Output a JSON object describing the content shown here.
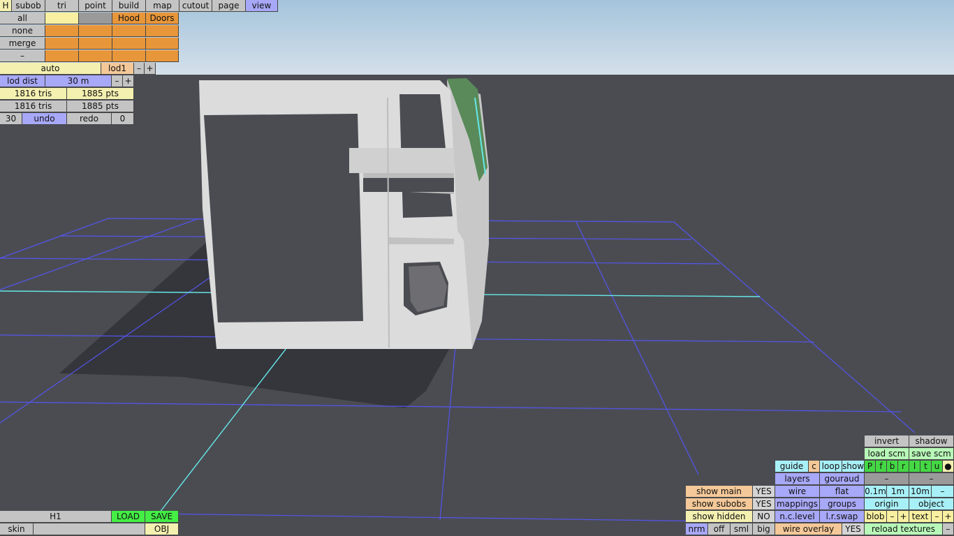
{
  "scene": {
    "colors": {
      "sky_top": "#a4c4dc",
      "sky_bottom": "#d4e0ea",
      "floor": "#4a4c52",
      "grid": "#5555ee",
      "axis": "#66e8e8",
      "body": "#d8d8d8",
      "stripe": "#5a8a5a",
      "shadow": "#34363c"
    }
  },
  "toolbar": {
    "modes": [
      "H",
      "subob",
      "tri",
      "point",
      "build",
      "map",
      "cutout",
      "page",
      "view"
    ],
    "active_mode": "view"
  },
  "subobjects": {
    "side_buttons": [
      "all",
      "none",
      "merge",
      "–"
    ],
    "named": [
      "Hood",
      "Doors"
    ]
  },
  "lod": {
    "auto": "auto",
    "level": "lod1",
    "minus": "–",
    "plus": "+",
    "dist_label": "lod dist",
    "dist_value": "30 m"
  },
  "stats": {
    "tris1": "1816 tris",
    "pts1": "1885 pts",
    "tris2": "1816 tris",
    "pts2": "1885 pts"
  },
  "history": {
    "count": "30",
    "undo": "undo",
    "redo": "redo",
    "redo_count": "0"
  },
  "file": {
    "name": "H1",
    "load": "LOAD",
    "save": "SAVE",
    "skin": "skin",
    "obj": "OBJ"
  },
  "view_panel": {
    "invert": "invert",
    "shadow": "shadow",
    "load_scm": "load scm",
    "save_scm": "save scm",
    "guide": "guide",
    "c": "c",
    "loop": "loop",
    "show": "show",
    "letters": [
      "P",
      "f",
      "b",
      "r",
      "l",
      "t",
      "u",
      "●"
    ],
    "layers": "layers",
    "gouraud": "gouraud",
    "dash": "–",
    "wire": "wire",
    "flat": "flat",
    "grid_sizes": [
      "0.1m",
      "1m",
      "10m"
    ],
    "mappings": "mappings",
    "groups": "groups",
    "origin": "origin",
    "object": "object",
    "nc_level": "n.c.level",
    "lr_swap": "l.r.swap",
    "blob": "blob",
    "text": "text",
    "minus": "–",
    "plus": "+",
    "wire_overlay": "wire overlay",
    "reload_textures": "reload textures",
    "show_main": "show main",
    "show_subobs": "show subobs",
    "show_hidden": "show hidden",
    "yes": "YES",
    "no": "NO",
    "sizes": [
      "nrm",
      "off",
      "sml",
      "big"
    ]
  }
}
